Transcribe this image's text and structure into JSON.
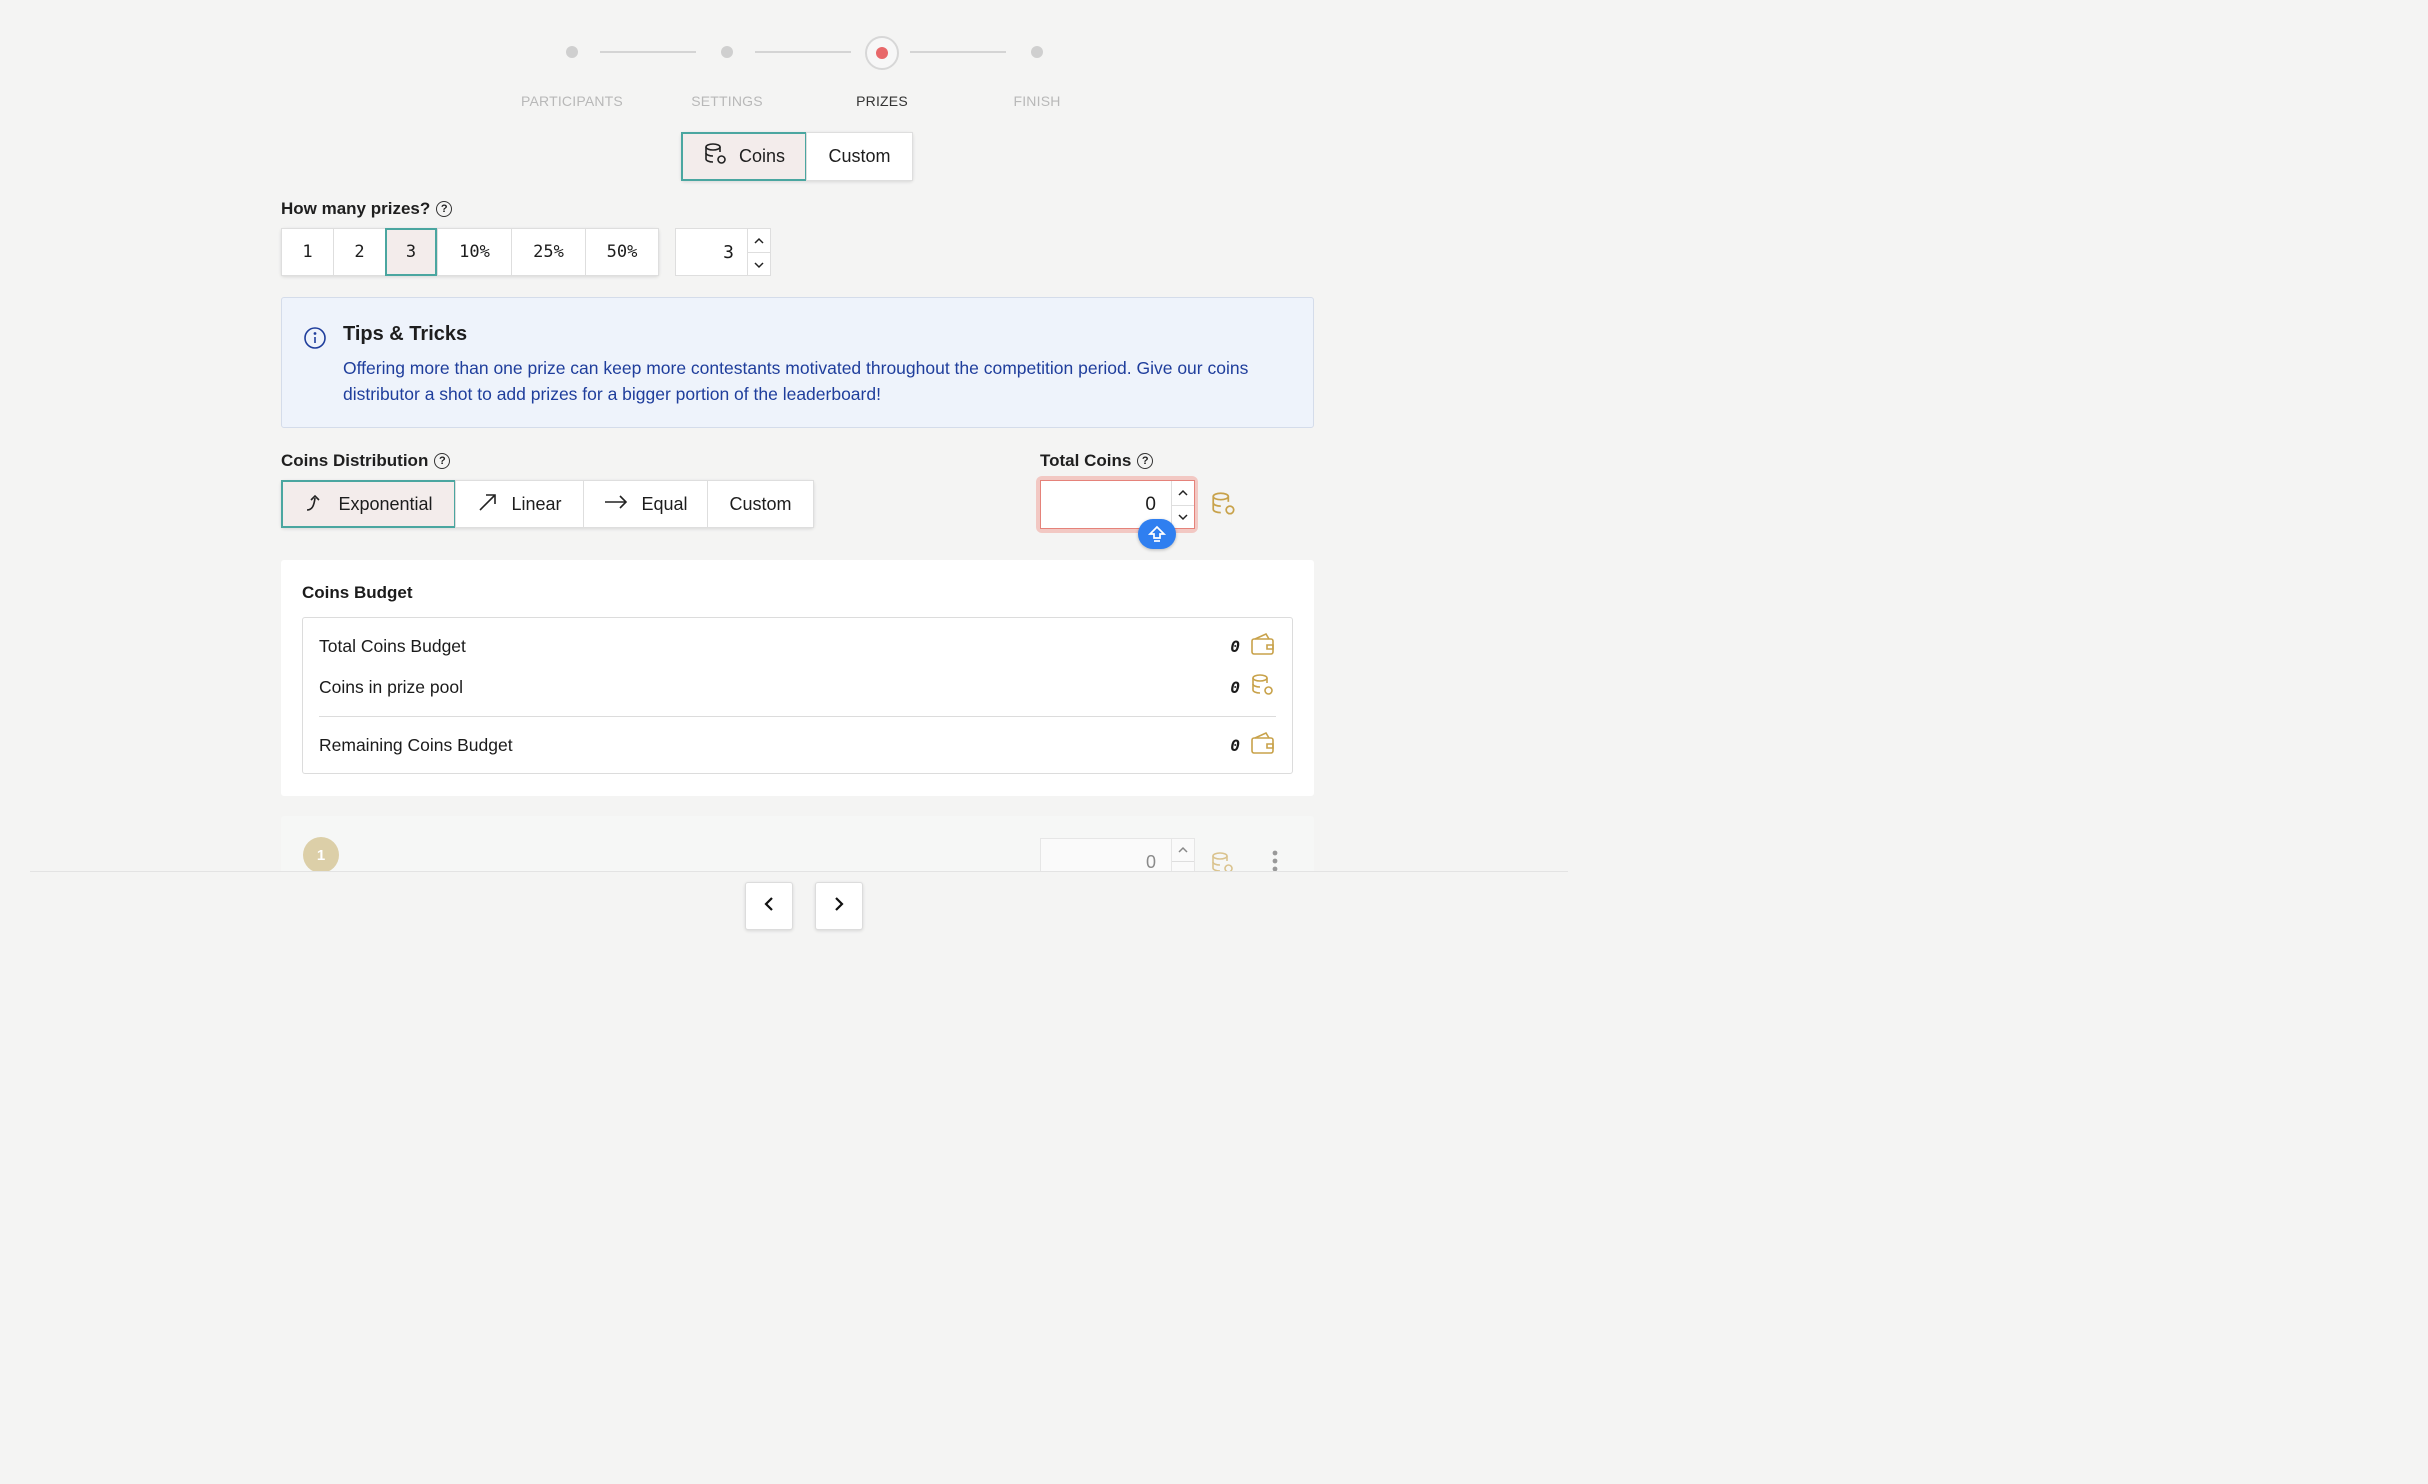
{
  "stepper": {
    "steps": [
      {
        "label": "PARTICIPANTS",
        "state": "done"
      },
      {
        "label": "SETTINGS",
        "state": "done"
      },
      {
        "label": "PRIZES",
        "state": "active"
      },
      {
        "label": "FINISH",
        "state": "pending"
      }
    ],
    "active_color": "#e8686a"
  },
  "prize_type": {
    "options": [
      "Coins",
      "Custom"
    ],
    "selected": "Coins"
  },
  "prize_count": {
    "label": "How many prizes?",
    "help": "?",
    "options": [
      "1",
      "2",
      "3",
      "10%",
      "25%",
      "50%"
    ],
    "selected": "3",
    "value": "3"
  },
  "tips": {
    "title": "Tips & Tricks",
    "text": "Offering more than one prize can keep more contestants motivated throughout the competition period. Give our coins distributor a shot to add prizes for a bigger portion of the leaderboard!"
  },
  "distribution": {
    "label": "Coins Distribution",
    "help": "?",
    "options": [
      {
        "label": "Exponential",
        "icon": "exponential-arrow-icon"
      },
      {
        "label": "Linear",
        "icon": "linear-arrow-icon"
      },
      {
        "label": "Equal",
        "icon": "right-arrow-icon"
      },
      {
        "label": "Custom",
        "icon": ""
      }
    ],
    "selected": "Exponential"
  },
  "total_coins": {
    "label": "Total Coins",
    "help": "?",
    "value": "0",
    "error_color": "#e8928c"
  },
  "budget": {
    "title": "Coins Budget",
    "rows": [
      {
        "label": "Total Coins Budget",
        "value": "0",
        "icon": "wallet-icon"
      },
      {
        "label": "Coins in prize pool",
        "value": "0",
        "icon": "coins-icon"
      },
      {
        "label": "Remaining Coins Budget",
        "value": "0",
        "icon": "wallet-icon"
      }
    ]
  },
  "prizes": [
    {
      "rank": "1",
      "coins": "0"
    }
  ],
  "colors": {
    "accent": "#4aa6a0",
    "gold": "#c8a24a",
    "info_blue": "#1f3e9c",
    "upload_blue": "#2f7ff0"
  }
}
